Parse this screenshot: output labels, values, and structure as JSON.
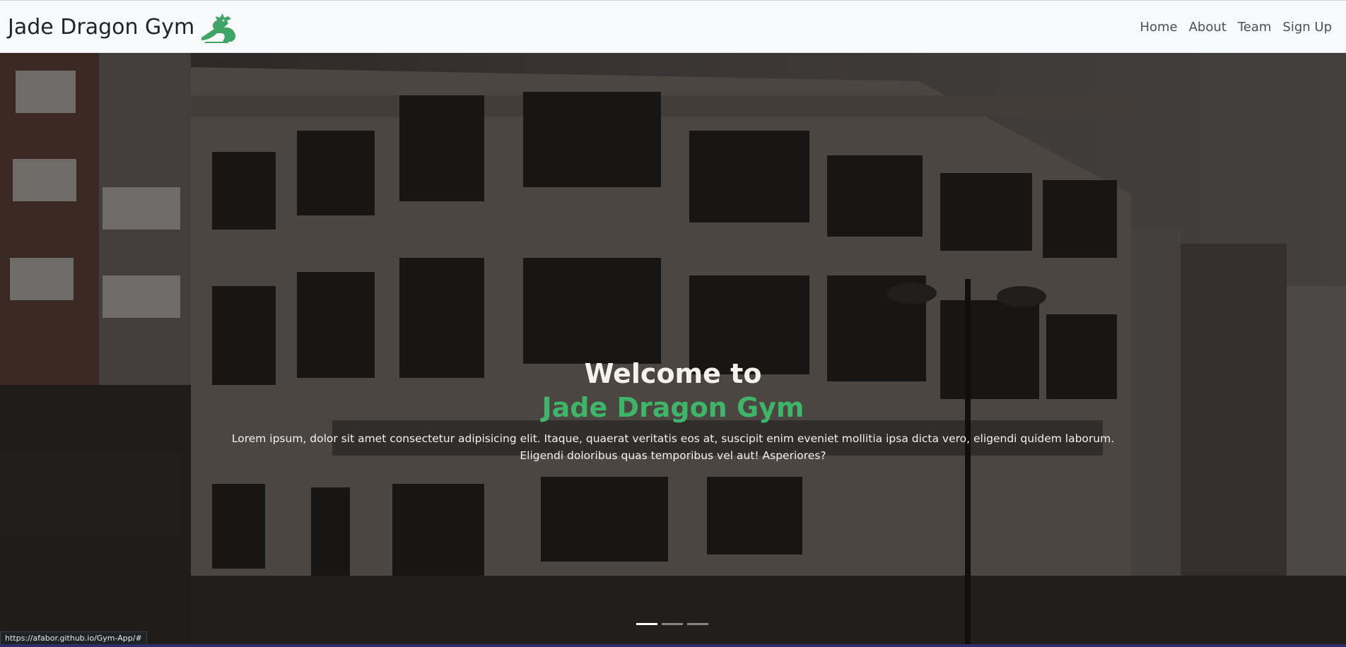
{
  "navbar": {
    "brand": "Jade Dragon Gym",
    "brand_logo_icon": "dragon-icon",
    "links": [
      "Home",
      "About",
      "Team",
      "Sign Up"
    ]
  },
  "hero": {
    "title_line1": "Welcome to",
    "title_line2": "Jade Dragon Gym",
    "paragraph": "Lorem ipsum, dolor sit amet consectetur adipisicing elit. Itaque, quaerat veritatis eos at, suscipit enim eveniet mollitia ipsa dicta vero, eligendi quidem laborum. Eligendi doloribus quas temporibus vel aut! Asperiores?",
    "carousel_slides": 3,
    "active_slide": 1
  },
  "status_bar": {
    "url": "https://afabor.github.io/Gym-App/#"
  },
  "colors": {
    "accent_green": "#3fb56a",
    "navbar_bg": "#f8f9fa",
    "nav_link": "#495057"
  }
}
